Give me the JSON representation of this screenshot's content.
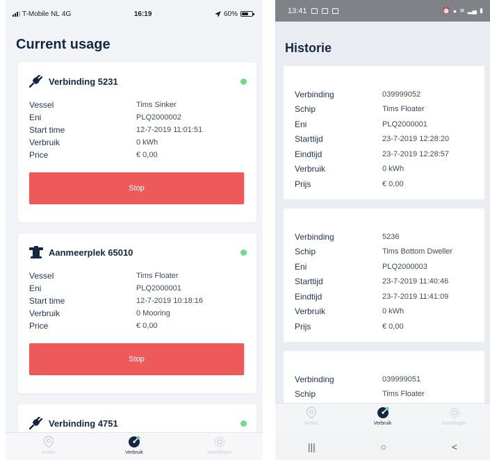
{
  "left": {
    "status": {
      "carrier": "T-Mobile NL",
      "network": "4G",
      "time": "16:19",
      "battery": "60%"
    },
    "title": "Current usage",
    "cards": [
      {
        "title": "Verbinding 5231",
        "icon": "plug-icon",
        "rows": [
          {
            "label": "Vessel",
            "value": "Tims Sinker"
          },
          {
            "label": "Eni",
            "value": "PLQ2000002"
          },
          {
            "label": "Start time",
            "value": "12-7-2019 11:01:51"
          },
          {
            "label": "Verbruik",
            "value": "0 kWh"
          },
          {
            "label": "Price",
            "value": "€ 0,00"
          }
        ],
        "button": "Stop"
      },
      {
        "title": "Aanmeerplek 65010",
        "icon": "mooring-icon",
        "rows": [
          {
            "label": "Vessel",
            "value": "Tims Floater"
          },
          {
            "label": "Eni",
            "value": "PLQ2000001"
          },
          {
            "label": "Start time",
            "value": "12-7-2019 10:18:16"
          },
          {
            "label": "Verbruik",
            "value": "0 Mooring"
          },
          {
            "label": "Price",
            "value": "€ 0,00"
          }
        ],
        "button": "Stop"
      },
      {
        "title": "Verbinding 4751",
        "icon": "plug-icon"
      }
    ],
    "tabs": [
      {
        "label": "Acties",
        "icon": "location-pin-icon"
      },
      {
        "label": "Verbruik",
        "icon": "gauge-icon"
      },
      {
        "label": "Instellingen",
        "icon": "gear-icon"
      }
    ]
  },
  "right": {
    "status": {
      "time": "13:41"
    },
    "title": "Historie",
    "items": [
      {
        "rows": [
          {
            "label": "Verbinding",
            "value": "039999052"
          },
          {
            "label": "Schip",
            "value": "Tims Floater"
          },
          {
            "label": "Eni",
            "value": "PLQ2000001"
          },
          {
            "label": "Starttijd",
            "value": "23-7-2019 12:28:20"
          },
          {
            "label": "Eindtijd",
            "value": "23-7-2019 12:28:57"
          },
          {
            "label": "Verbruik",
            "value": "0 kWh"
          },
          {
            "label": "Prijs",
            "value": "€ 0,00"
          }
        ]
      },
      {
        "rows": [
          {
            "label": "Verbinding",
            "value": "5236"
          },
          {
            "label": "Schip",
            "value": "Tims Bottom Dweller"
          },
          {
            "label": "Eni",
            "value": "PLQ2000003"
          },
          {
            "label": "Starttijd",
            "value": "23-7-2019 11:40:46"
          },
          {
            "label": "Eindtijd",
            "value": "23-7-2019 11:41:09"
          },
          {
            "label": "Verbruik",
            "value": "0 kWh"
          },
          {
            "label": "Prijs",
            "value": "€ 0,00"
          }
        ]
      },
      {
        "rows": [
          {
            "label": "Verbinding",
            "value": "039999051"
          },
          {
            "label": "Schip",
            "value": "Tims Floater"
          }
        ]
      }
    ],
    "tabs": [
      {
        "label": "Acties",
        "icon": "location-pin-icon"
      },
      {
        "label": "Verbruik",
        "icon": "gauge-icon"
      },
      {
        "label": "Instellingen",
        "icon": "gear-icon"
      }
    ],
    "nav": {
      "recents": "|||",
      "home": "○",
      "back": "<"
    }
  },
  "colors": {
    "accent_red": "#ee5a5a",
    "status_green": "#6fd98c",
    "title_navy": "#152743"
  }
}
